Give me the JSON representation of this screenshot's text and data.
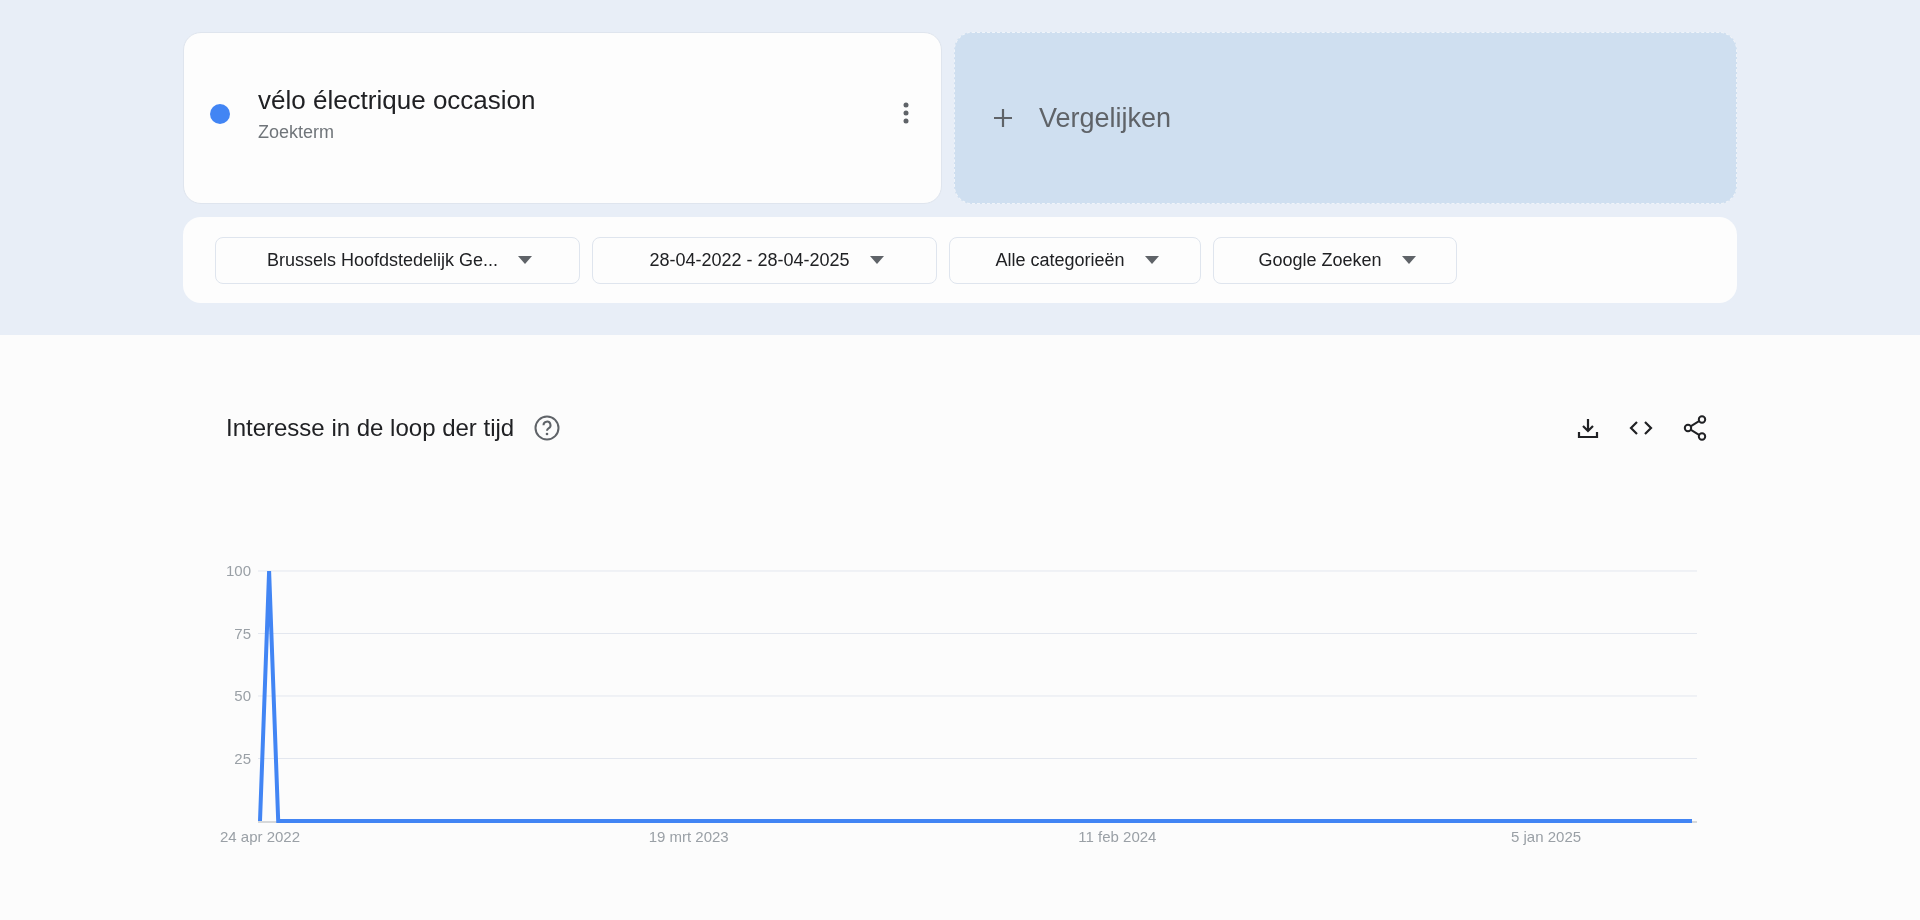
{
  "search_term": {
    "label": "vélo électrique occasion",
    "type_label": "Zoekterm",
    "color": "#4285f4"
  },
  "compare": {
    "label": "Vergelijken"
  },
  "filters": [
    {
      "label": "Brussels Hoofdstedelijk Ge..."
    },
    {
      "label": "28-04-2022 - 28-04-2025"
    },
    {
      "label": "Alle categorieën"
    },
    {
      "label": "Google Zoeken"
    }
  ],
  "interest_over_time": {
    "title": "Interesse in de loop der tijd",
    "chart_data": {
      "type": "line",
      "grid": true,
      "ylim": [
        0,
        100
      ],
      "yticks": [
        25,
        50,
        75,
        100
      ],
      "categories": [
        "24 apr 2022",
        null,
        null,
        null,
        null,
        null,
        null,
        null,
        null,
        null,
        null,
        null,
        null,
        null,
        null,
        null,
        null,
        null,
        null,
        null,
        null,
        null,
        null,
        null,
        null,
        null,
        null,
        null,
        null,
        null,
        null,
        null,
        null,
        null,
        null,
        null,
        null,
        null,
        null,
        null,
        null,
        null,
        null,
        null,
        null,
        null,
        null,
        "19 mrt 2023",
        null,
        null,
        null,
        null,
        null,
        null,
        null,
        null,
        null,
        null,
        null,
        null,
        null,
        null,
        null,
        null,
        null,
        null,
        null,
        null,
        null,
        null,
        null,
        null,
        null,
        null,
        null,
        null,
        null,
        null,
        null,
        null,
        null,
        null,
        null,
        null,
        null,
        null,
        null,
        null,
        null,
        null,
        null,
        null,
        null,
        null,
        "11 feb 2024",
        null,
        null,
        null,
        null,
        null,
        null,
        null,
        null,
        null,
        null,
        null,
        null,
        null,
        null,
        null,
        null,
        null,
        null,
        null,
        null,
        null,
        null,
        null,
        null,
        null,
        null,
        null,
        null,
        null,
        null,
        null,
        null,
        null,
        null,
        null,
        null,
        null,
        null,
        null,
        null,
        null,
        null,
        null,
        null,
        null,
        null,
        "5 jan 2025",
        null,
        null,
        null,
        null,
        null,
        null,
        null,
        null,
        null,
        null,
        null,
        null,
        null,
        null,
        null,
        null
      ],
      "series": [
        {
          "color": "#4285f4",
          "values": [
            0,
            100,
            0,
            0,
            0,
            0,
            0,
            0,
            0,
            0,
            0,
            0,
            0,
            0,
            0,
            0,
            0,
            0,
            0,
            0,
            0,
            0,
            0,
            0,
            0,
            0,
            0,
            0,
            0,
            0,
            0,
            0,
            0,
            0,
            0,
            0,
            0,
            0,
            0,
            0,
            0,
            0,
            0,
            0,
            0,
            0,
            0,
            0,
            0,
            0,
            0,
            0,
            0,
            0,
            0,
            0,
            0,
            0,
            0,
            0,
            0,
            0,
            0,
            0,
            0,
            0,
            0,
            0,
            0,
            0,
            0,
            0,
            0,
            0,
            0,
            0,
            0,
            0,
            0,
            0,
            0,
            0,
            0,
            0,
            0,
            0,
            0,
            0,
            0,
            0,
            0,
            0,
            0,
            0,
            0,
            0,
            0,
            0,
            0,
            0,
            0,
            0,
            0,
            0,
            0,
            0,
            0,
            0,
            0,
            0,
            0,
            0,
            0,
            0,
            0,
            0,
            0,
            0,
            0,
            0,
            0,
            0,
            0,
            0,
            0,
            0,
            0,
            0,
            0,
            0,
            0,
            0,
            0,
            0,
            0,
            0,
            0,
            0,
            0,
            0,
            0,
            0,
            0,
            0,
            0,
            0,
            0,
            0,
            0,
            0,
            0,
            0,
            0,
            0,
            0,
            0,
            0,
            0
          ]
        }
      ]
    }
  }
}
